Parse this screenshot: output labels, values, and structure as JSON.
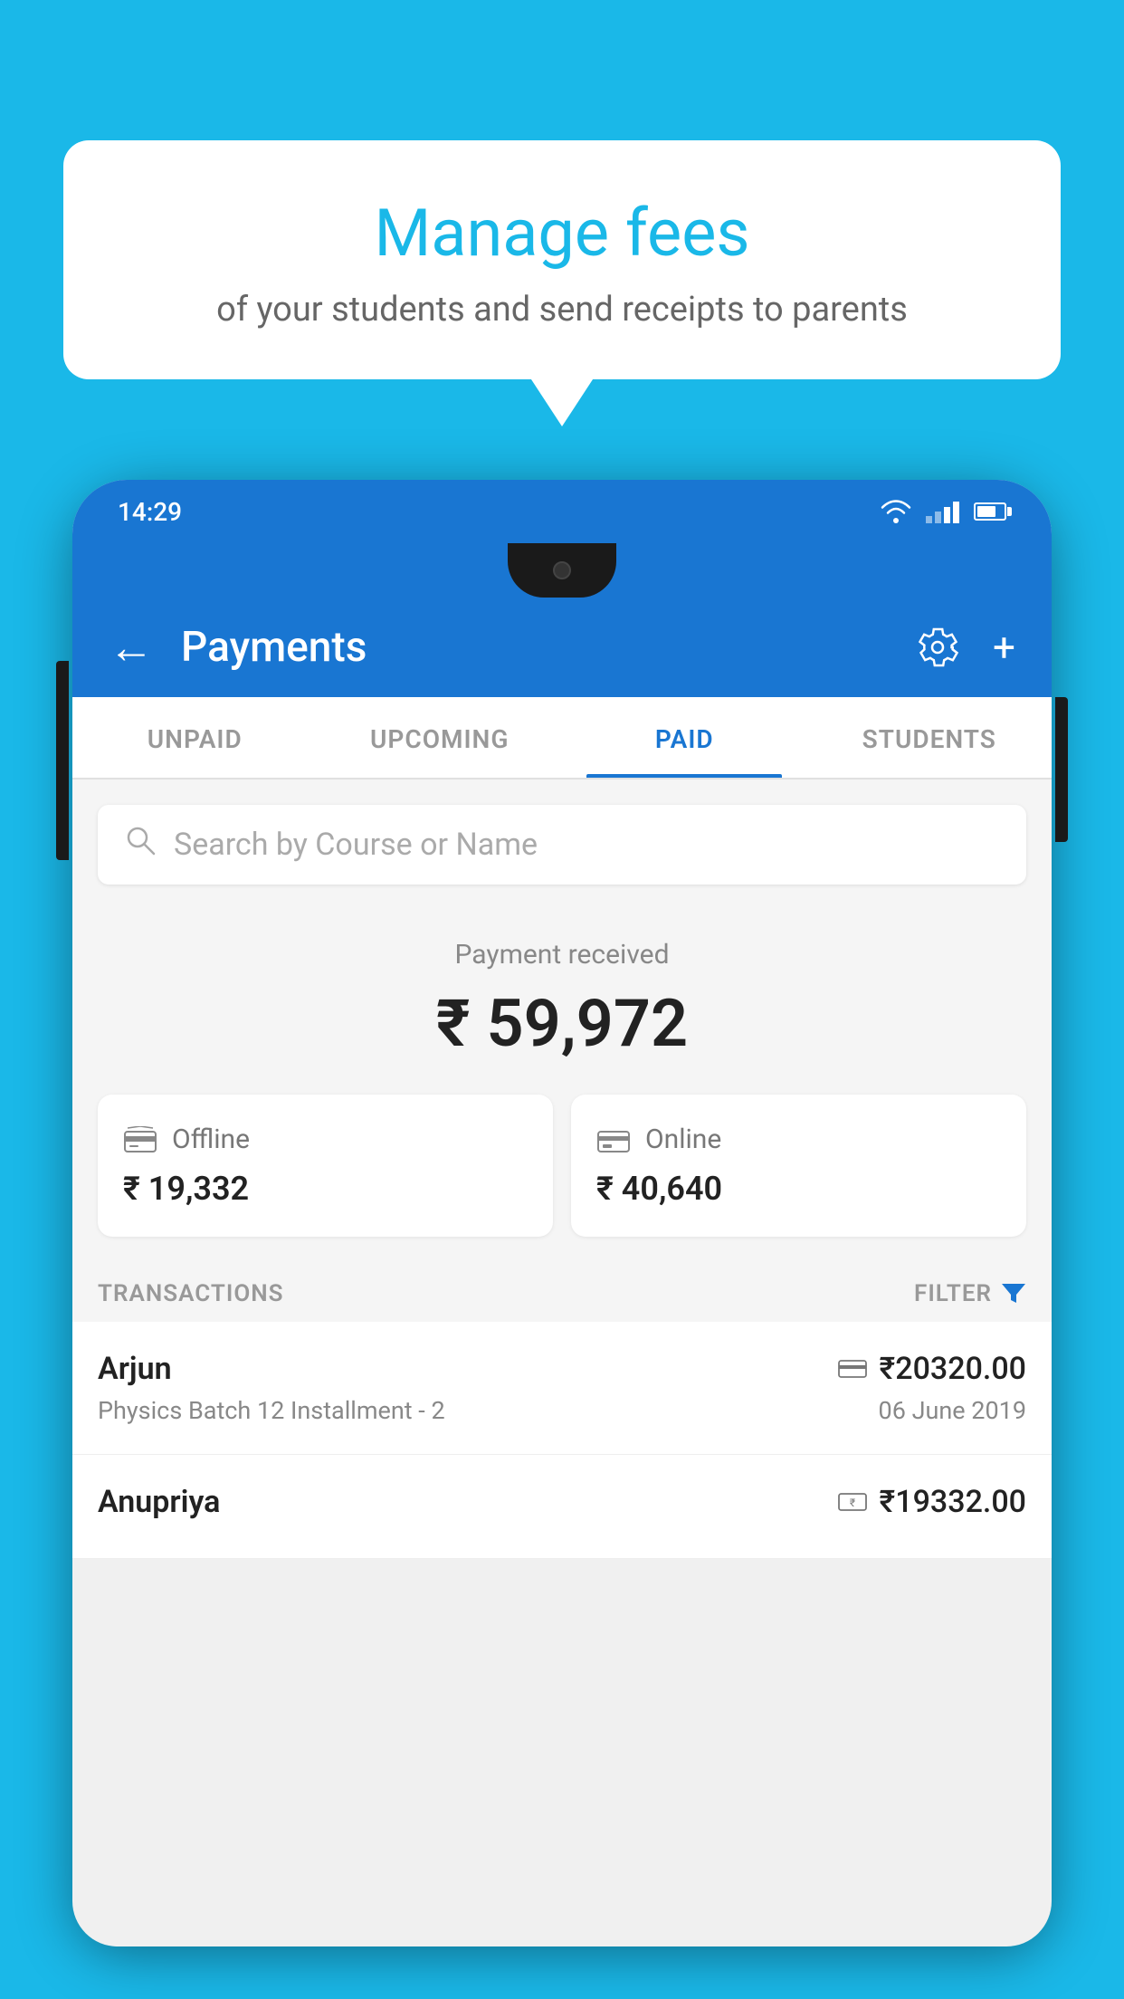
{
  "background_color": "#1ab8e8",
  "bubble": {
    "title": "Manage fees",
    "subtitle": "of your students and send receipts to parents"
  },
  "phone": {
    "status_bar": {
      "time": "14:29"
    },
    "header": {
      "title": "Payments",
      "back_label": "←",
      "settings_label": "⚙",
      "add_label": "+"
    },
    "tabs": [
      {
        "label": "UNPAID",
        "active": false
      },
      {
        "label": "UPCOMING",
        "active": false
      },
      {
        "label": "PAID",
        "active": true
      },
      {
        "label": "STUDENTS",
        "active": false
      }
    ],
    "search": {
      "placeholder": "Search by Course or Name"
    },
    "payment_summary": {
      "label": "Payment received",
      "amount": "₹ 59,972"
    },
    "payment_cards": [
      {
        "label": "Offline",
        "amount": "₹ 19,332",
        "icon": "₹"
      },
      {
        "label": "Online",
        "amount": "₹ 40,640",
        "icon": "▭"
      }
    ],
    "transactions_label": "TRANSACTIONS",
    "filter_label": "FILTER",
    "transactions": [
      {
        "name": "Arjun",
        "description": "Physics Batch 12 Installment - 2",
        "amount": "₹20320.00",
        "date": "06 June 2019",
        "icon": "▭"
      },
      {
        "name": "Anupriya",
        "description": "",
        "amount": "₹19332.00",
        "date": "",
        "icon": "₹"
      }
    ]
  }
}
